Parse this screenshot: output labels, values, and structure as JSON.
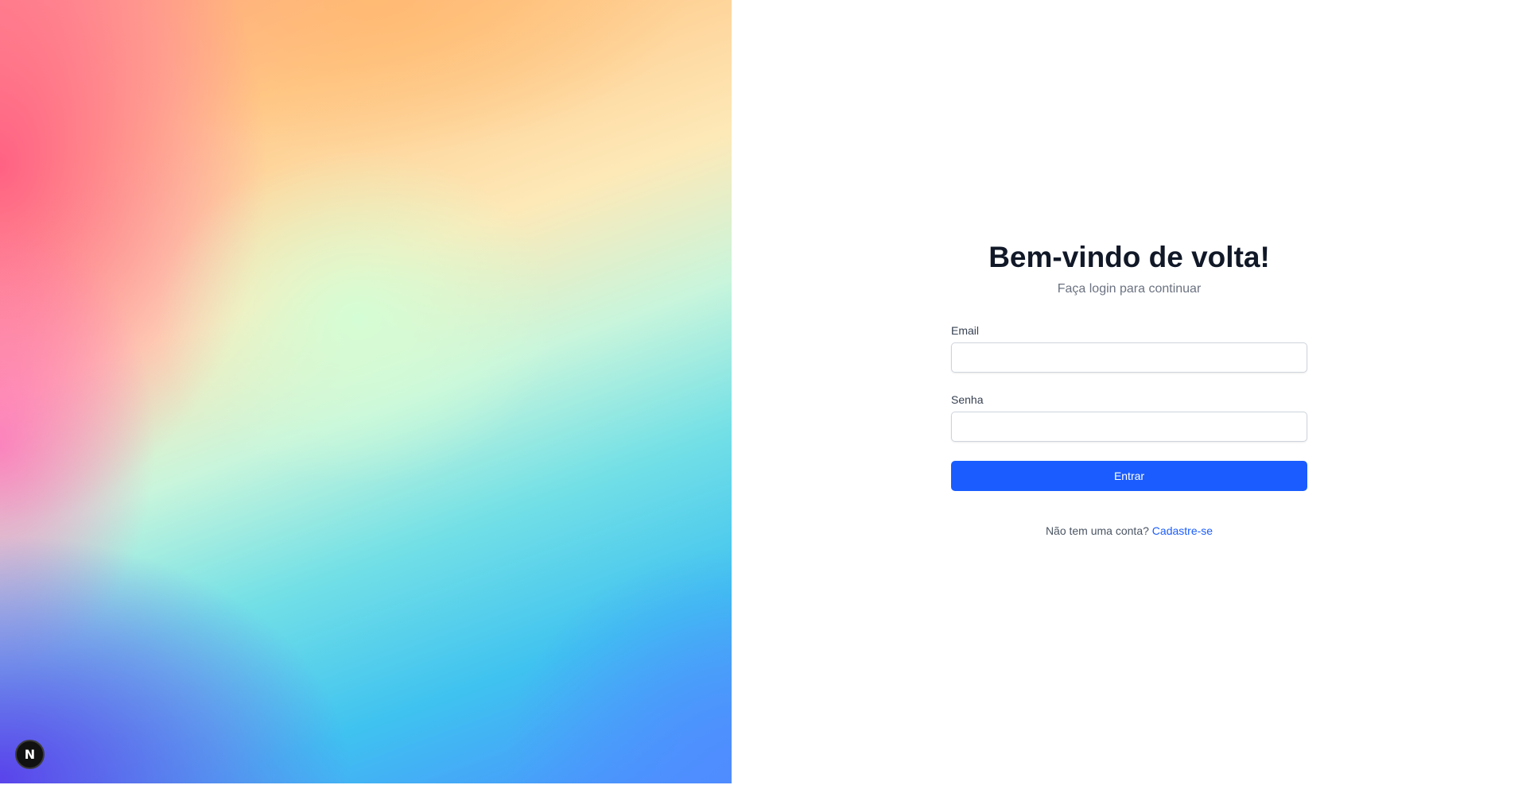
{
  "hero": {
    "badge_letter": "N",
    "colors": [
      "#ff5a82",
      "#ffc98a",
      "#fde9b8",
      "#c8f5dc",
      "#74e0e6",
      "#3fc2f0",
      "#5a3ceb"
    ]
  },
  "login": {
    "title": "Bem-vindo de volta!",
    "subtitle": "Faça login para continuar",
    "email_label": "Email",
    "email_value": "",
    "password_label": "Senha",
    "password_value": "",
    "submit_label": "Entrar",
    "signup_prompt": "Não tem uma conta?",
    "signup_link": "Cadastre-se",
    "accent_color": "#1a5cff"
  }
}
